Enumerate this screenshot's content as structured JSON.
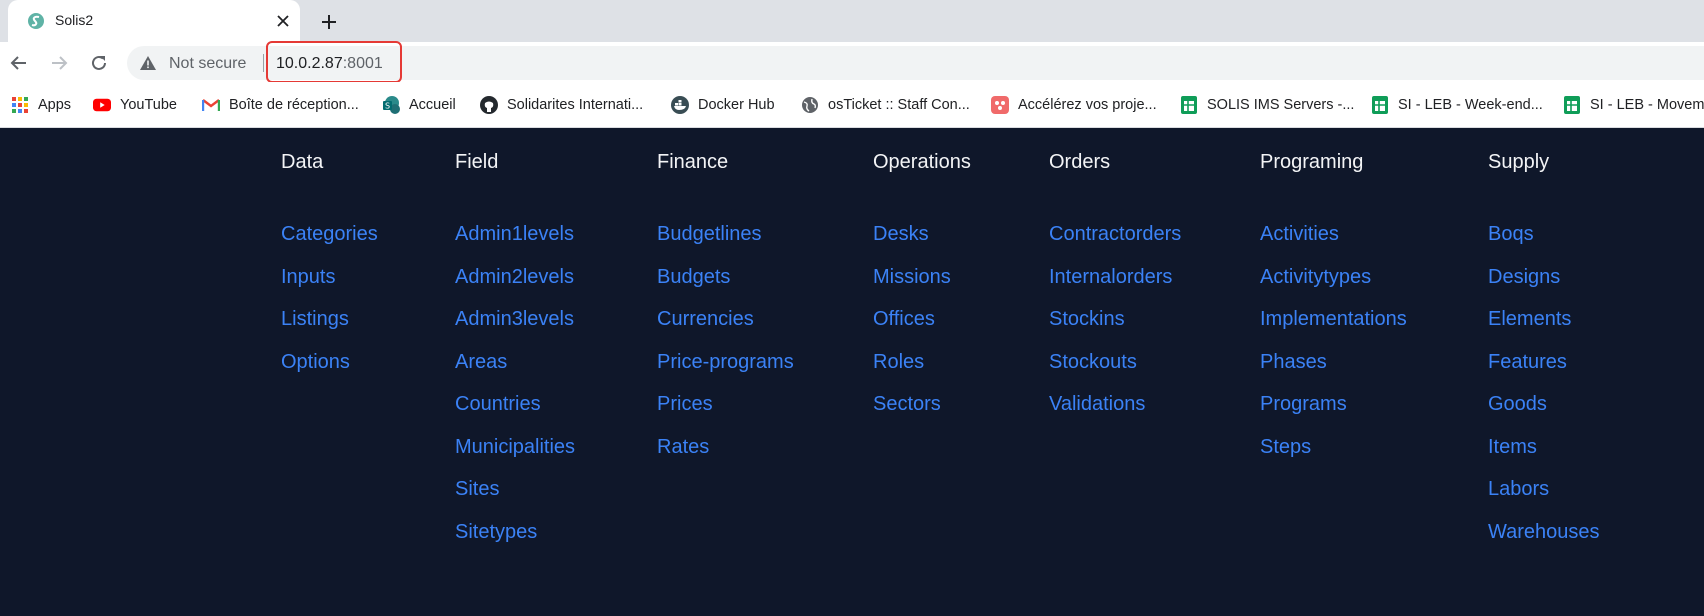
{
  "browser": {
    "tab": {
      "title": "Solis2"
    },
    "address": {
      "security_label": "Not secure",
      "host": "10.0.2.87",
      "port": ":8001"
    },
    "bookmarks": [
      {
        "label": "Apps",
        "icon": "apps-grid-icon"
      },
      {
        "label": "YouTube",
        "icon": "youtube-icon"
      },
      {
        "label": "Boîte de réception...",
        "icon": "gmail-icon"
      },
      {
        "label": "Accueil",
        "icon": "sharepoint-icon"
      },
      {
        "label": "Solidarites Internati...",
        "icon": "github-icon"
      },
      {
        "label": "Docker Hub",
        "icon": "docker-icon"
      },
      {
        "label": "osTicket :: Staff Con...",
        "icon": "globe-icon"
      },
      {
        "label": "Accélérez vos proje...",
        "icon": "app-icon"
      },
      {
        "label": "SOLIS IMS Servers -...",
        "icon": "sheets-icon"
      },
      {
        "label": "SI - LEB - Week-end...",
        "icon": "sheets-icon"
      },
      {
        "label": "SI - LEB - Movem",
        "icon": "sheets-icon"
      }
    ]
  },
  "menu": {
    "columns": [
      {
        "header": "Data",
        "items": [
          "Categories",
          "Inputs",
          "Listings",
          "Options"
        ]
      },
      {
        "header": "Field",
        "items": [
          "Admin1levels",
          "Admin2levels",
          "Admin3levels",
          "Areas",
          "Countries",
          "Municipalities",
          "Sites",
          "Sitetypes"
        ]
      },
      {
        "header": "Finance",
        "items": [
          "Budgetlines",
          "Budgets",
          "Currencies",
          "Price-programs",
          "Prices",
          "Rates"
        ]
      },
      {
        "header": "Operations",
        "items": [
          "Desks",
          "Missions",
          "Offices",
          "Roles",
          "Sectors"
        ]
      },
      {
        "header": "Orders",
        "items": [
          "Contractorders",
          "Internalorders",
          "Stockins",
          "Stockouts",
          "Validations"
        ]
      },
      {
        "header": "Programing",
        "items": [
          "Activities",
          "Activitytypes",
          "Implementations",
          "Phases",
          "Programs",
          "Steps"
        ]
      },
      {
        "header": "Supply",
        "items": [
          "Boqs",
          "Designs",
          "Elements",
          "Features",
          "Goods",
          "Items",
          "Labors",
          "Warehouses"
        ]
      }
    ]
  },
  "colors": {
    "page_bg": "#0f172a",
    "link": "#3b82f6",
    "header_text": "#f3f4f6",
    "highlight": "#e53935"
  }
}
